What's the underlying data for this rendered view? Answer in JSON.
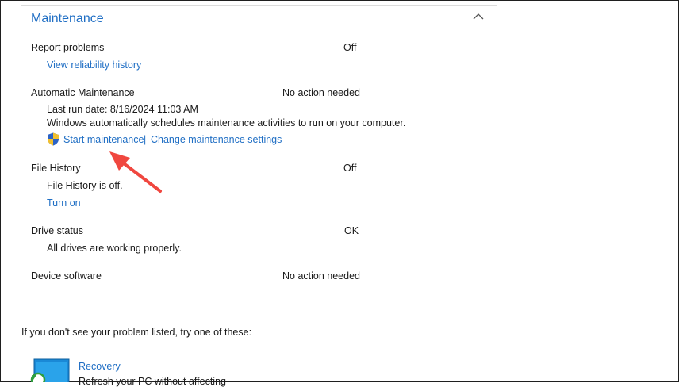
{
  "section": {
    "title": "Maintenance"
  },
  "items": {
    "report_problems": {
      "label": "Report problems",
      "status": "Off",
      "link": "View reliability history"
    },
    "automatic_maintenance": {
      "label": "Automatic Maintenance",
      "status": "No action needed",
      "last_run": "Last run date: 8/16/2024 11:03 AM",
      "description": "Windows automatically schedules maintenance activities to run on your computer.",
      "start_link": "Start maintenance",
      "separator": "|",
      "settings_link": "Change maintenance settings"
    },
    "file_history": {
      "label": "File History",
      "status": "Off",
      "description": "File History is off.",
      "link": "Turn on"
    },
    "drive_status": {
      "label": "Drive status",
      "status": "OK",
      "description": "All drives are working properly."
    },
    "device_software": {
      "label": "Device software",
      "status": "No action needed"
    }
  },
  "footer": {
    "prompt": "If you don't see your problem listed, try one of these:",
    "recovery_link": "Recovery",
    "recovery_description": "Refresh your PC without affecting"
  },
  "colors": {
    "link": "#1f6ec4",
    "annotation_arrow": "#f0473f"
  },
  "icons": [
    "chevron-up-icon",
    "uac-shield-icon",
    "recovery-icon",
    "annotation-arrow"
  ]
}
